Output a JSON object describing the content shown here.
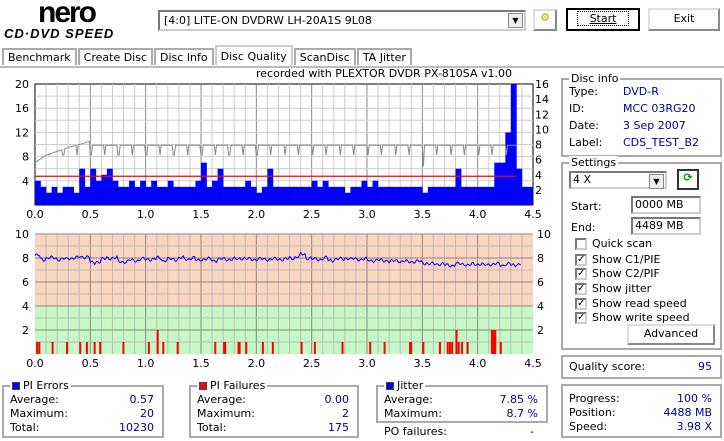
{
  "header": {
    "logo_top": "nero",
    "logo_bottom": "CD·DVD SPEED",
    "drive": "[4:0]  LITE-ON DVDRW LH-20A1S 9L08",
    "start_label": "Start",
    "exit_label": "Exit"
  },
  "tabs": [
    {
      "label": "Benchmark"
    },
    {
      "label": "Create Disc"
    },
    {
      "label": "Disc Info"
    },
    {
      "label": "Disc Quality",
      "active": true
    },
    {
      "label": "ScanDisc"
    },
    {
      "label": "TA Jitter"
    }
  ],
  "recorded_with": "recorded with PLEXTOR DVDR   PX-810SA  v1.00",
  "disc_info": {
    "title": "Disc info",
    "type_label": "Type:",
    "type": "DVD-R",
    "id_label": "ID:",
    "id": "MCC 03RG20",
    "date_label": "Date:",
    "date": "3 Sep 2007",
    "label_label": "Label:",
    "label": "CDS_TEST_B2"
  },
  "settings": {
    "title": "Settings",
    "speed": "4 X",
    "start_label": "Start:",
    "start": "0000 MB",
    "end_label": "End:",
    "end": "4489 MB",
    "checkboxes": [
      {
        "label": "Quick scan",
        "checked": false
      },
      {
        "label": "Show C1/PIE",
        "checked": true
      },
      {
        "label": "Show C2/PIF",
        "checked": true
      },
      {
        "label": "Show jitter",
        "checked": true
      },
      {
        "label": "Show read speed",
        "checked": true
      },
      {
        "label": "Show write speed",
        "checked": true
      }
    ],
    "advanced_label": "Advanced"
  },
  "quality": {
    "label": "Quality score:",
    "value": "95"
  },
  "progress": {
    "progress_label": "Progress:",
    "progress": "100 %",
    "position_label": "Position:",
    "position": "4488 MB",
    "speed_label": "Speed:",
    "speed": "3.98 X"
  },
  "pi_errors": {
    "title": "PI Errors",
    "avg_label": "Average:",
    "avg": "0.57",
    "max_label": "Maximum:",
    "max": "20",
    "total_label": "Total:",
    "total": "10230"
  },
  "pi_failures": {
    "title": "PI Failures",
    "avg_label": "Average:",
    "avg": "0.00",
    "max_label": "Maximum:",
    "max": "2",
    "total_label": "Total:",
    "total": "175"
  },
  "jitter": {
    "title": "Jitter",
    "avg_label": "Average:",
    "avg": "7.85 %",
    "max_label": "Maximum:",
    "max": "8.7 %",
    "po_label": "PO failures:",
    "po": "-"
  },
  "colors": {
    "pie": "#0000ff",
    "pif": "#ff0000",
    "jitter": "#0000ff",
    "speed": "#888888",
    "threshold": "#ff0000",
    "bad_zone": "#fcd5c0",
    "good_zone": "#c4f8c4"
  },
  "chart_data": [
    {
      "type": "bar",
      "name": "PI Errors / read speed",
      "xlim": [
        0,
        4.5
      ],
      "ylim_left": [
        0,
        20
      ],
      "ylim_right": [
        0,
        16
      ],
      "xticks": [
        "0.0",
        "0.5",
        "1.0",
        "1.5",
        "2.0",
        "2.5",
        "3.0",
        "3.5",
        "4.0",
        "4.5"
      ],
      "yticks_left": [
        "4",
        "8",
        "12",
        "16",
        "20"
      ],
      "yticks_right": [
        "2",
        "4",
        "6",
        "8",
        "10",
        "12",
        "14",
        "16"
      ],
      "threshold_right": 3.8,
      "x_step": 0.05,
      "pie": [
        4,
        3,
        2,
        3,
        2,
        3,
        3,
        2,
        6,
        3,
        6,
        4,
        5,
        6,
        4,
        3,
        3,
        4,
        3,
        4,
        3,
        4,
        3,
        3,
        4,
        3,
        3,
        3,
        3,
        4,
        7,
        3,
        4,
        6,
        3,
        3,
        3,
        3,
        4,
        3,
        2,
        3,
        6,
        3,
        3,
        3,
        3,
        3,
        3,
        3,
        4,
        3,
        4,
        3,
        3,
        3,
        2,
        3,
        3,
        4,
        3,
        4,
        3,
        3,
        3,
        3,
        3,
        3,
        3,
        3,
        2,
        3,
        3,
        3,
        3,
        3,
        6,
        3,
        3,
        3,
        3,
        3,
        3,
        7,
        7,
        12,
        20,
        6,
        3,
        3
      ],
      "speed": [
        [
          0,
          5.6
        ],
        [
          0.1,
          6.6
        ],
        [
          0.2,
          7.1
        ],
        [
          0.3,
          7.6
        ],
        [
          0.4,
          8.0
        ],
        [
          0.49,
          8.4
        ],
        [
          0.5,
          7.9
        ],
        [
          4.35,
          7.9
        ]
      ],
      "speed_dip_every": 0.125,
      "speed_dip_to": 6.6
    },
    {
      "type": "line",
      "name": "Jitter / PI Failures",
      "xlim": [
        0,
        4.5
      ],
      "ylim": [
        0,
        10
      ],
      "xticks": [
        "0.0",
        "0.5",
        "1.0",
        "1.5",
        "2.0",
        "2.5",
        "3.0",
        "3.5",
        "4.0",
        "4.5"
      ],
      "yticks": [
        "2",
        "4",
        "6",
        "8",
        "10"
      ],
      "good_below": 4,
      "jitter": [
        8.2,
        7.9,
        8.0,
        8.0,
        7.9,
        7.9,
        8.0,
        8.0,
        8.1,
        8.1,
        7.6,
        7.7,
        7.9,
        8.0,
        8.0,
        7.7,
        7.7,
        7.8,
        7.8,
        7.9,
        7.9,
        7.9,
        8.0,
        7.8,
        7.9,
        7.9,
        8.0,
        7.9,
        8.0,
        7.8,
        7.9,
        7.9,
        7.8,
        7.9,
        7.9,
        7.9,
        7.9,
        8.0,
        7.9,
        7.9,
        7.9,
        7.9,
        7.9,
        7.9,
        7.9,
        7.9,
        8.0,
        8.1,
        8.3,
        8.0,
        7.9,
        7.9,
        8.0,
        7.8,
        7.9,
        7.9,
        8.0,
        7.9,
        7.9,
        7.9,
        7.8,
        7.8,
        7.8,
        7.8,
        7.7,
        7.8,
        7.7,
        7.7,
        7.7,
        7.7,
        7.6,
        7.5,
        7.5,
        7.5,
        7.4,
        7.4,
        7.5,
        7.5,
        7.4,
        7.5,
        7.5,
        7.4,
        7.5,
        7.5,
        7.4,
        7.5,
        7.4,
        7.5
      ],
      "pif": [
        [
          0.01,
          1
        ],
        [
          0.03,
          1
        ],
        [
          0.15,
          1
        ],
        [
          0.28,
          1
        ],
        [
          0.4,
          1
        ],
        [
          0.46,
          1
        ],
        [
          0.53,
          1
        ],
        [
          0.58,
          1
        ],
        [
          0.79,
          1
        ],
        [
          1.02,
          1
        ],
        [
          1.1,
          2
        ],
        [
          1.15,
          1
        ],
        [
          1.28,
          1
        ],
        [
          1.62,
          1
        ],
        [
          1.7,
          1
        ],
        [
          1.71,
          1
        ],
        [
          1.83,
          1
        ],
        [
          1.84,
          1
        ],
        [
          1.9,
          1
        ],
        [
          2.05,
          1
        ],
        [
          2.14,
          1
        ],
        [
          2.4,
          1
        ],
        [
          2.52,
          1
        ],
        [
          2.77,
          1
        ],
        [
          3.02,
          1
        ],
        [
          3.15,
          1
        ],
        [
          3.38,
          1
        ],
        [
          3.39,
          1
        ],
        [
          3.5,
          1
        ],
        [
          3.65,
          1
        ],
        [
          3.72,
          1
        ],
        [
          3.74,
          1
        ],
        [
          3.76,
          1
        ],
        [
          3.8,
          2
        ],
        [
          3.82,
          1
        ],
        [
          3.85,
          1
        ],
        [
          3.9,
          1
        ],
        [
          4.12,
          2
        ],
        [
          4.13,
          2
        ],
        [
          4.14,
          2
        ],
        [
          4.15,
          2
        ],
        [
          4.2,
          1
        ]
      ]
    }
  ]
}
